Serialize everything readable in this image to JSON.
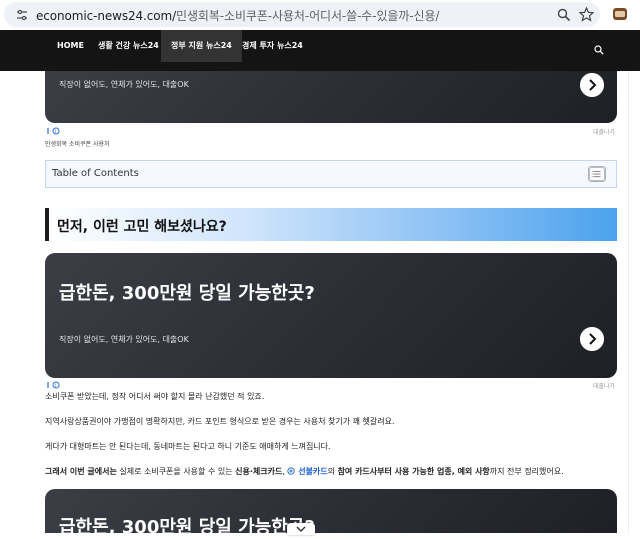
{
  "browser": {
    "url_domain": "economic-news24.com/",
    "url_path": "민생회복-소비쿠폰-사용처-어디서-쓸-수-있을까-신용/"
  },
  "nav": {
    "items": [
      {
        "label": "HOME"
      },
      {
        "label": "생활 건강 뉴스24"
      },
      {
        "label": "정부 지원 뉴스24"
      },
      {
        "label": "경제 투자 뉴스24"
      }
    ],
    "active_index": 2
  },
  "promo_top": {
    "subtitle": "직장이 없어도, 연체가 있어도, 대출OK"
  },
  "ad_marker_1": {
    "label": "대출나가"
  },
  "image_caption": "민생회복 소비쿠폰 사용처",
  "toc": {
    "label": "Table of Contents"
  },
  "section": {
    "title": "먼저, 이런 고민 해보셨나요?"
  },
  "promo_main": {
    "title": "급한돈, 300만원 당일 가능한곳?",
    "subtitle": "직장이 없어도, 연체가 있어도, 대출OK"
  },
  "ad_marker_2": {
    "label": "대출나가"
  },
  "paragraphs": {
    "p1": "소비쿠폰 받았는데, 정작 어디서 써야 할지 몰라 난감했던 적 있죠.",
    "p2": "지역사랑상품권이야 가맹점이 명확하지만, 카드 포인트 형식으로 받은 경우는 사용처 찾기가 꽤 헷갈려요.",
    "p3": "게다가 대형마트는 안 된다는데, 동네마트는 된다고 하니 기준도 애매하게 느껴집니다.",
    "p4": {
      "a": "그래서 이번 글에서는",
      "b": " 실제로 소비쿠폰을 사용할 수 있는 ",
      "c": "신용·체크카드",
      "d": ", ",
      "e": "선불카드",
      "f": "의 ",
      "g": "참여 카드사부터 사용 가능한 업종, 예외 사항",
      "h": "까지 전부 정리했어요."
    }
  },
  "promo_bottom": {
    "title": "급한돈, 300만원 당일 가능한곳?"
  },
  "colors": {
    "nav_bg": "#141414",
    "link": "#1a5fd0",
    "heading_gradient_end": "#4ba2ee"
  }
}
